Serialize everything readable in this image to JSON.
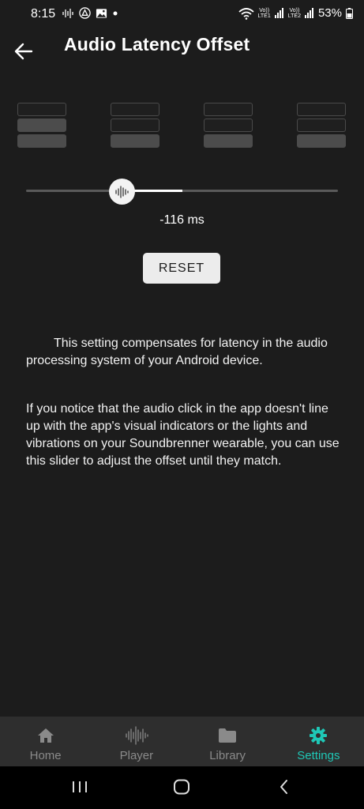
{
  "status": {
    "time": "8:15",
    "sim1_label_top": "Vo))",
    "sim1_label_bottom": "LTE1",
    "sim2_label_top": "Vo))",
    "sim2_label_bottom": "LTE2",
    "battery": "53%"
  },
  "header": {
    "title": "Audio Latency Offset"
  },
  "beat_indicator": {
    "columns": 4,
    "rows_per_column": 3
  },
  "slider": {
    "value": -116,
    "unit": "ms",
    "display": "-116 ms"
  },
  "reset_button": {
    "label": "RESET"
  },
  "description": {
    "paragraph_1": "This setting compensates for latency in the audio processing system of your Android device.",
    "paragraph_2": "If you notice that the audio click in the app doesn't line up with the app's visual indicators or the lights and vibrations on your Soundbrenner wearable, you can use this slider to adjust the offset until they match."
  },
  "bottom_nav": {
    "items": [
      {
        "label": "Home",
        "icon": "home-icon",
        "active": false
      },
      {
        "label": "Player",
        "icon": "waveform-icon",
        "active": false
      },
      {
        "label": "Library",
        "icon": "folder-icon",
        "active": false
      },
      {
        "label": "Settings",
        "icon": "gear-icon",
        "active": true
      }
    ]
  },
  "colors": {
    "background": "#1c1c1c",
    "accent": "#1fc7b6",
    "nav_background": "#2e2e2e"
  }
}
